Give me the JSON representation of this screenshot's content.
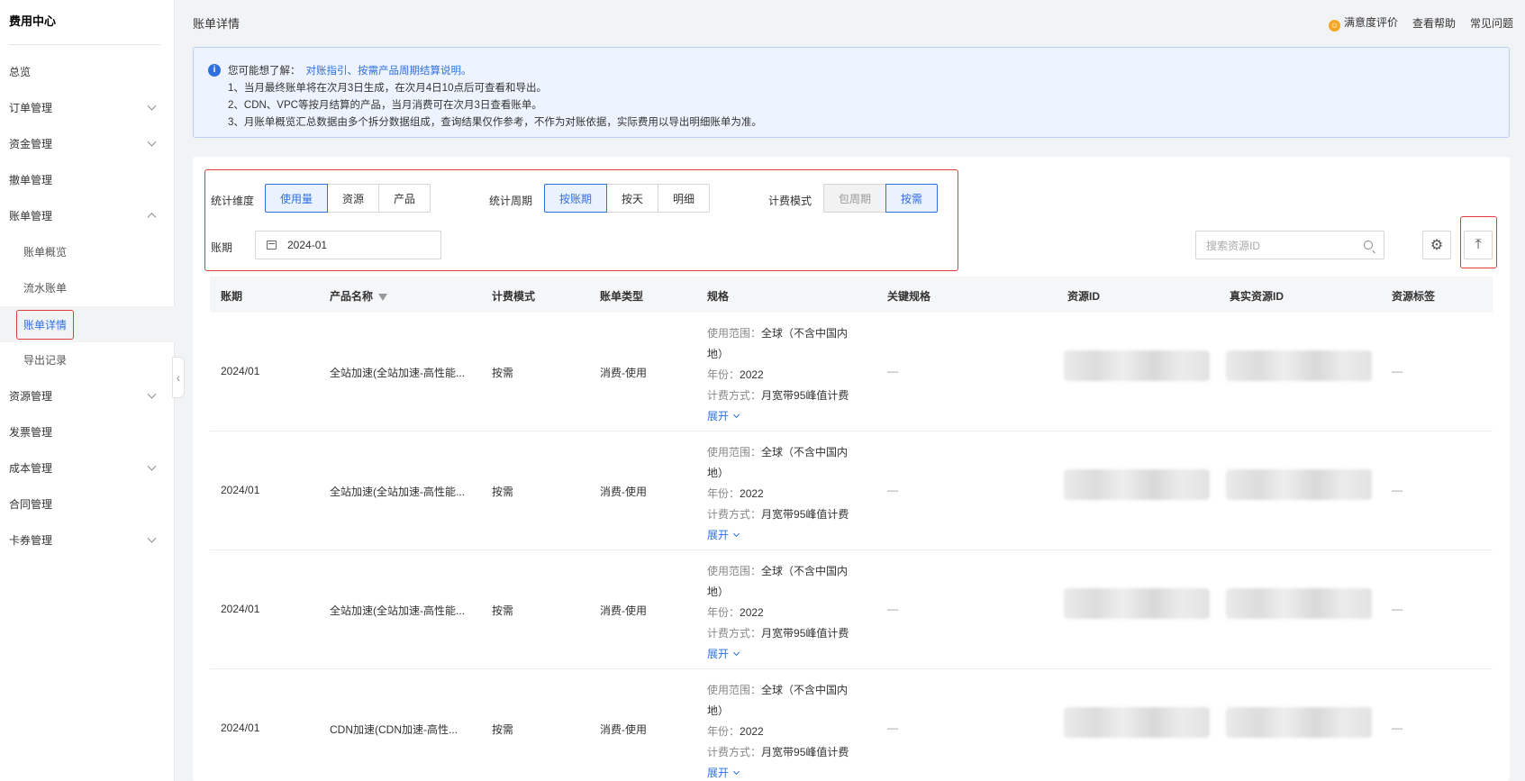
{
  "sidebar": {
    "brand": "费用中心",
    "items": [
      {
        "label": "总览",
        "chevron": "none"
      },
      {
        "label": "订单管理",
        "chevron": "down"
      },
      {
        "label": "资金管理",
        "chevron": "down"
      },
      {
        "label": "撤单管理",
        "chevron": "none"
      },
      {
        "label": "账单管理",
        "chevron": "up"
      },
      {
        "label": "账单概览",
        "sub": true
      },
      {
        "label": "流水账单",
        "sub": true
      },
      {
        "label": "账单详情",
        "sub": true,
        "active": true
      },
      {
        "label": "导出记录",
        "sub": true
      },
      {
        "label": "资源管理",
        "chevron": "down"
      },
      {
        "label": "发票管理",
        "chevron": "none"
      },
      {
        "label": "成本管理",
        "chevron": "down"
      },
      {
        "label": "合同管理",
        "chevron": "none"
      },
      {
        "label": "卡券管理",
        "chevron": "down"
      }
    ],
    "collapse_glyph": "‹"
  },
  "header": {
    "title": "账单详情",
    "links": {
      "satisfaction": "满意度评价",
      "help": "查看帮助",
      "faq": "常见问题"
    }
  },
  "notice": {
    "icon_text": "i",
    "lead": "您可能想了解：",
    "link": "对账指引、按需产品周期结算说明。",
    "lines": [
      "1、当月最终账单将在次月3日生成，在次月4日10点后可查看和导出。",
      "2、CDN、VPC等按月结算的产品，当月消费可在次月3日查看账单。",
      "3、月账单概览汇总数据由多个拆分数据组成，查询结果仅作参考，不作为对账依据，实际费用以导出明细账单为准。"
    ]
  },
  "filters": {
    "dimension": {
      "label": "统计维度",
      "options": [
        "使用量",
        "资源",
        "产品"
      ],
      "selected": "使用量"
    },
    "period": {
      "label": "统计周期",
      "options": [
        "按账期",
        "按天",
        "明细"
      ],
      "selected": "按账期"
    },
    "billing_mode": {
      "label": "计费模式",
      "options": [
        "包周期",
        "按需"
      ],
      "selected": "按需",
      "disabled": [
        "包周期"
      ]
    },
    "bill_period": {
      "label": "账期",
      "value": "2024-01"
    }
  },
  "search": {
    "placeholder": "搜索资源ID"
  },
  "icons": {
    "settings": "⚙",
    "export": "⤒",
    "filter": "filter-icon",
    "calendar": "calendar-icon"
  },
  "table": {
    "headers": [
      "账期",
      "产品名称",
      "计费模式",
      "账单类型",
      "规格",
      "关键规格",
      "资源ID",
      "真实资源ID",
      "资源标签"
    ],
    "spec_keys": {
      "scope": "使用范围：",
      "year": "年份：",
      "method": "计费方式："
    },
    "rows": [
      {
        "period": "2024/01",
        "product": "全站加速(全站加速-高性能...",
        "mode": "按需",
        "type": "消费-使用",
        "scope": "全球（不含中国内地）",
        "year": "2022",
        "method": "月宽带95峰值计费",
        "more": "展开",
        "key_spec": "—",
        "tag": "—"
      },
      {
        "period": "2024/01",
        "product": "全站加速(全站加速-高性能...",
        "mode": "按需",
        "type": "消费-使用",
        "scope": "全球（不含中国内地）",
        "year": "2022",
        "method": "月宽带95峰值计费",
        "more": "展开",
        "key_spec": "—",
        "tag": "—"
      },
      {
        "period": "2024/01",
        "product": "全站加速(全站加速-高性能...",
        "mode": "按需",
        "type": "消费-使用",
        "scope": "全球（不含中国内地）",
        "year": "2022",
        "method": "月宽带95峰值计费",
        "more": "展开",
        "key_spec": "—",
        "tag": "—"
      },
      {
        "period": "2024/01",
        "product": "CDN加速(CDN加速-高性...",
        "mode": "按需",
        "type": "消费-使用",
        "scope": "全球（不含中国内地）",
        "year": "2022",
        "method": "月宽带95峰值计费",
        "more": "展开",
        "key_spec": "—",
        "tag": "—"
      }
    ]
  }
}
